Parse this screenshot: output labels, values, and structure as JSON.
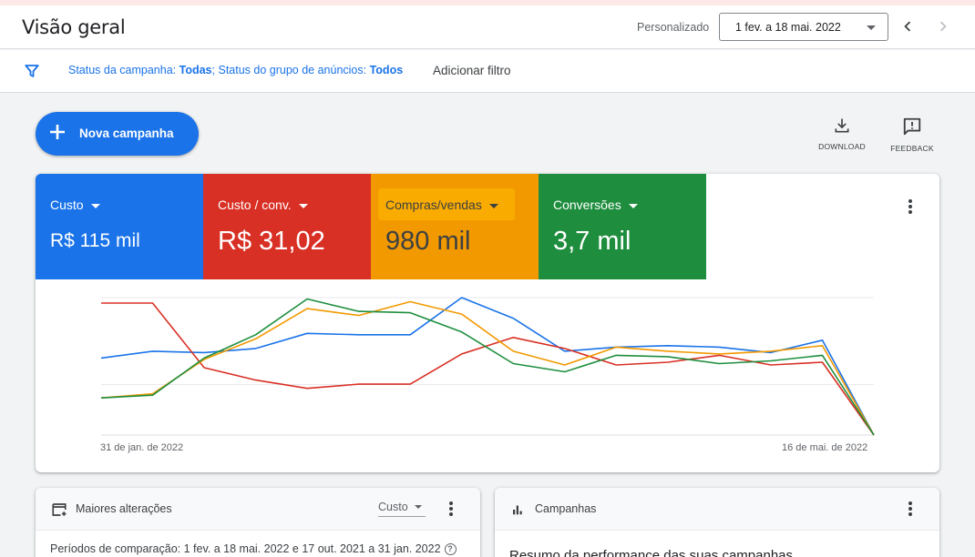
{
  "header": {
    "title": "Visão geral",
    "date_range_label": "Personalizado",
    "date_range_value": "1 fev. a 18 mai. 2022"
  },
  "filter_bar": {
    "campaign_status_label": "Status da campanha:",
    "campaign_status_value": "Todas",
    "separator": ";",
    "adgroup_status_label": "Status do grupo de anúncios:",
    "adgroup_status_value": "Todos",
    "add_filter_label": "Adicionar filtro"
  },
  "actions": {
    "new_campaign_label": "Nova campanha",
    "download_label": "DOWNLOAD",
    "feedback_label": "FEEDBACK"
  },
  "metrics": [
    {
      "name": "Custo",
      "value": "R$ 115 mil",
      "color": "#1a73e8"
    },
    {
      "name": "Custo / conv.",
      "value": "R$ 31,02",
      "color": "#d93025"
    },
    {
      "name": "Compras/vendas",
      "value": "980 mil",
      "color": "#f29900"
    },
    {
      "name": "Conversões",
      "value": "3,7 mil",
      "color": "#1e8e3e"
    }
  ],
  "chart_data": {
    "type": "line",
    "x_start_label": "31 de jan. de 2022",
    "x_end_label": "16 de mai. de 2022",
    "ylim": [
      0,
      100
    ],
    "grid": true,
    "series": [
      {
        "name": "Custo",
        "color": "#1a73e8",
        "values": [
          56,
          61,
          60,
          63,
          74,
          73,
          73,
          100,
          85,
          61,
          64,
          65,
          64,
          60,
          69,
          0
        ]
      },
      {
        "name": "Custo / conv.",
        "color": "#d93025",
        "values": [
          96,
          96,
          49,
          40,
          34,
          37,
          37,
          59,
          71,
          63,
          51,
          53,
          58,
          51,
          53,
          0
        ]
      },
      {
        "name": "Compras/vendas",
        "color": "#f29900",
        "values": [
          27,
          30,
          55,
          70,
          92,
          87,
          97,
          88,
          61,
          51,
          64,
          61,
          59,
          61,
          65,
          0
        ]
      },
      {
        "name": "Conversões",
        "color": "#1e8e3e",
        "values": [
          27,
          29,
          56,
          73,
          99,
          90,
          89,
          75,
          52,
          46,
          58,
          57,
          52,
          54,
          58,
          0
        ]
      }
    ]
  },
  "bottom_cards": {
    "biggest_changes": {
      "title": "Maiores alterações",
      "metric_select": "Custo",
      "comparison_text": "Períodos de comparação: 1 fev. a 18 mai. 2022 e 17 out. 2021 a 31 jan. 2022",
      "help_glyph": "?"
    },
    "campaigns": {
      "title": "Campanhas",
      "summary_text": "Resumo da performance das suas campanhas"
    }
  }
}
